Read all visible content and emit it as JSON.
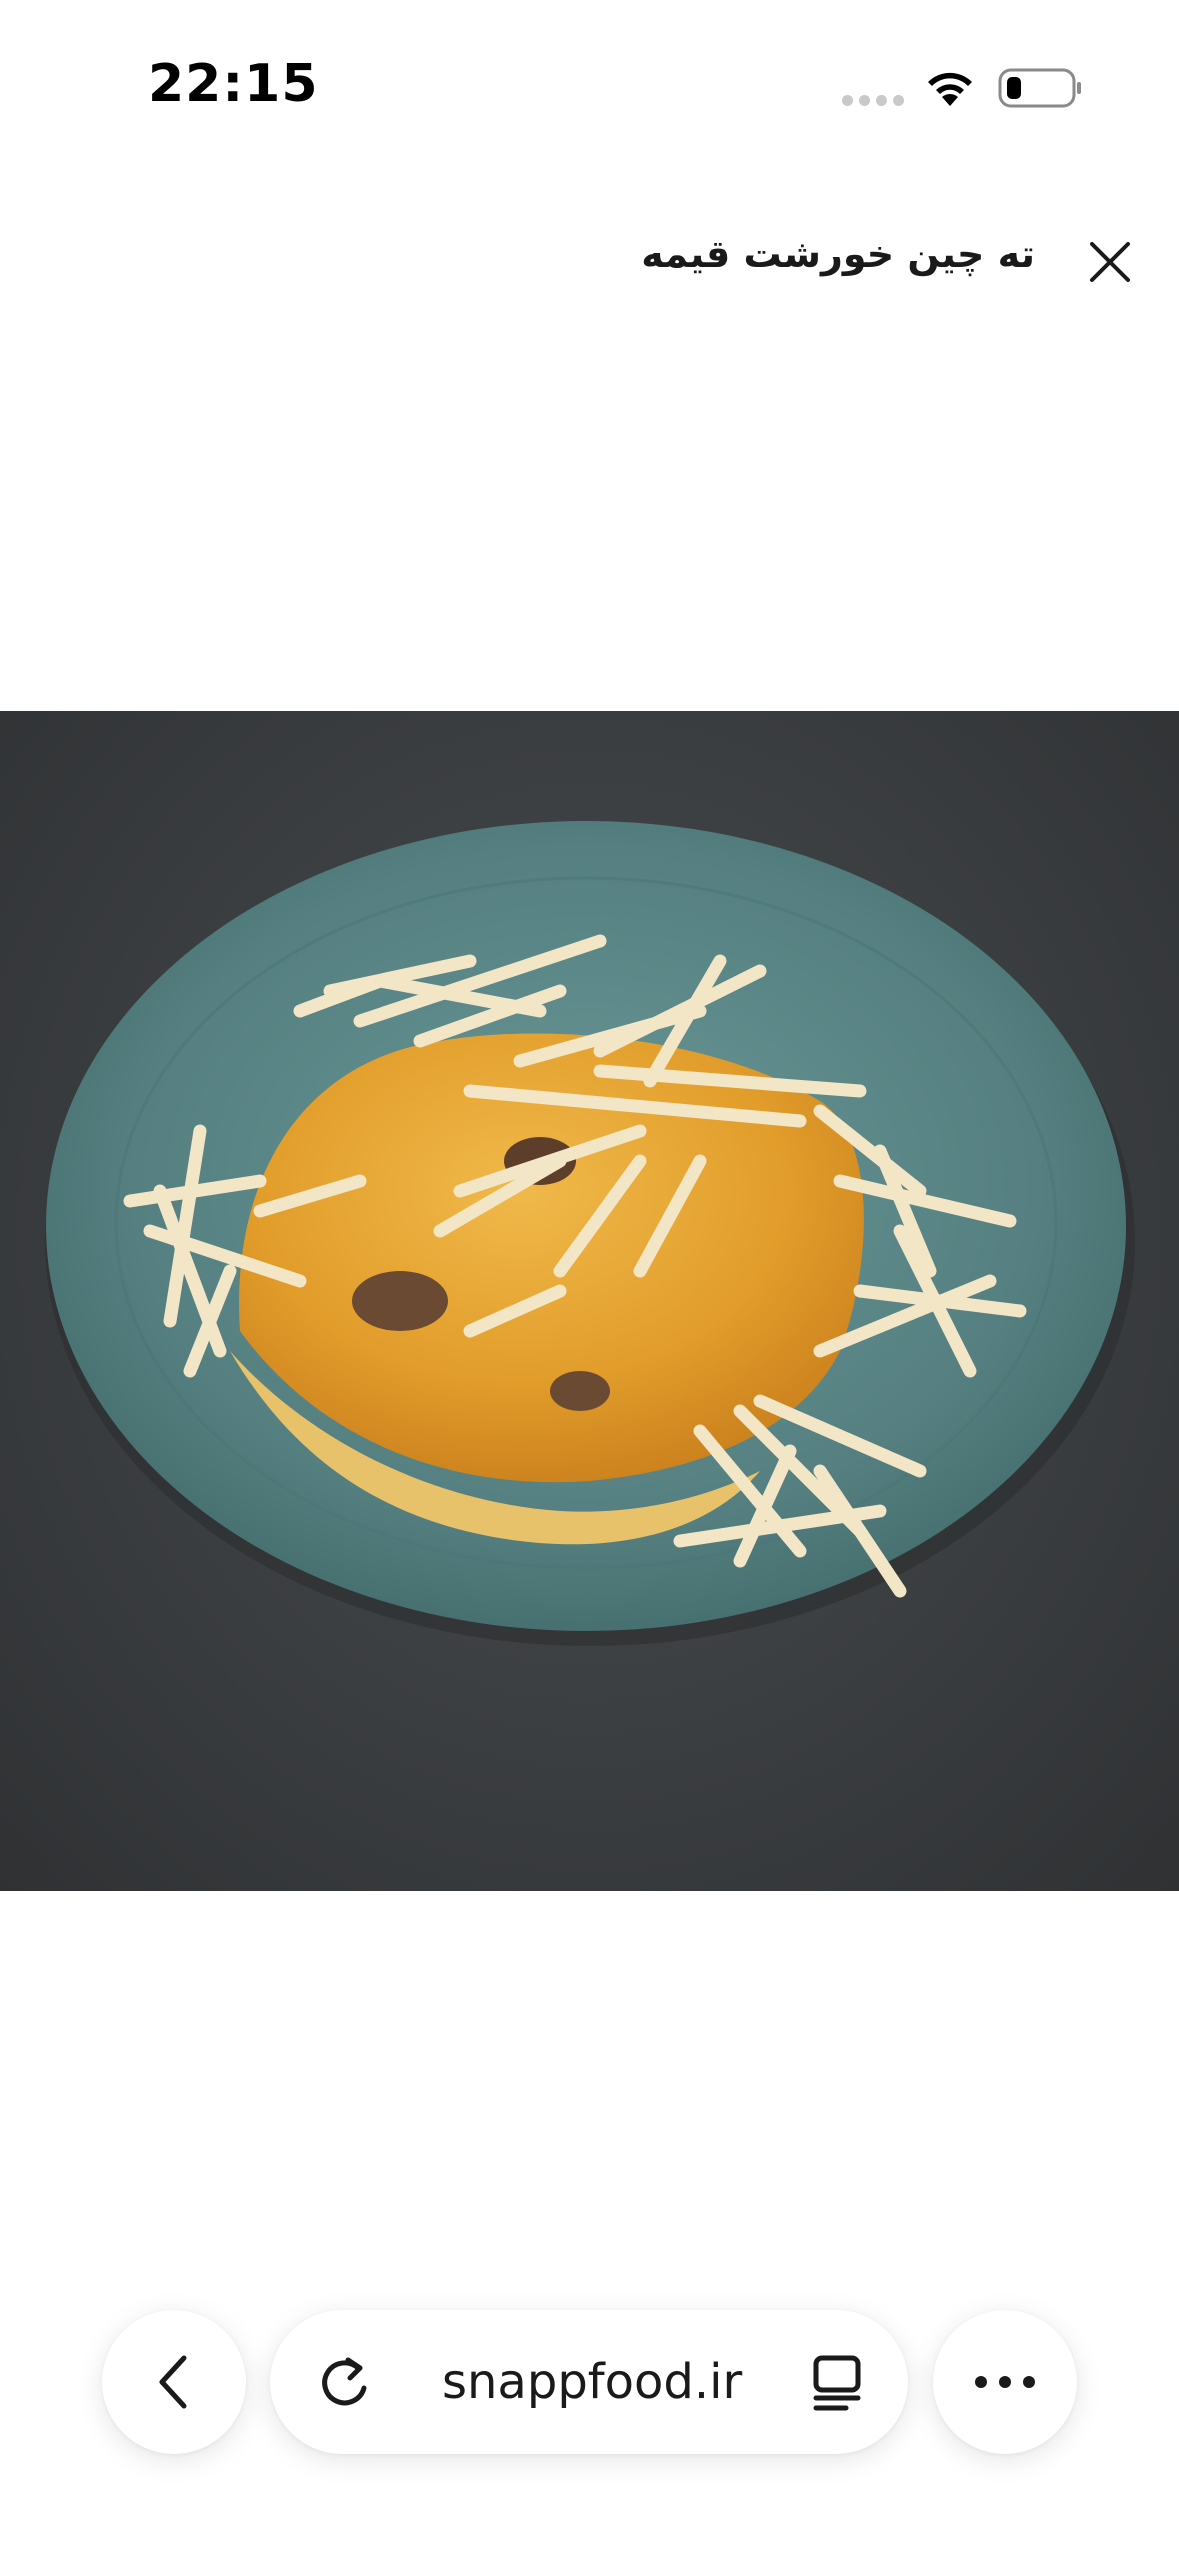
{
  "status_bar": {
    "time": "22:15"
  },
  "header": {
    "title": "ته چین خورشت قیمه",
    "close_icon": "close-icon"
  },
  "image": {
    "subject": "tahchin-with-gheymeh-stew-on-teal-plate"
  },
  "toolbar": {
    "back_icon": "chevron-left-icon",
    "reload_icon": "reload-icon",
    "url": "snappfood.ir",
    "reader_icon": "reader-mode-icon",
    "more_icon": "more-icon"
  },
  "colors": {
    "background": "#ffffff",
    "photo_background": "#3b3e41",
    "plate": "#5a8a8a",
    "rice": "#e4a935"
  }
}
